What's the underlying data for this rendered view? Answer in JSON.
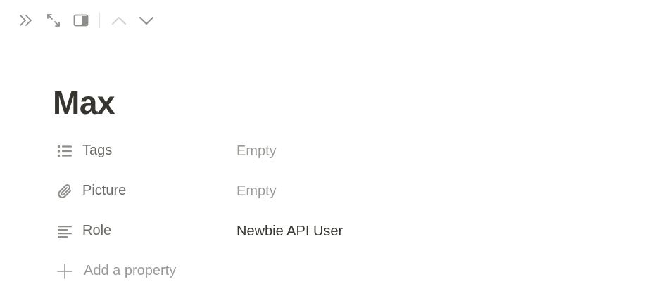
{
  "toolbar": {
    "buttons": [
      {
        "icon": "double-chevron-right-icon"
      },
      {
        "icon": "expand-diagonal-icon"
      },
      {
        "icon": "side-peek-icon"
      },
      {
        "icon": "chevron-up-icon"
      },
      {
        "icon": "chevron-down-icon"
      }
    ]
  },
  "page": {
    "title": "Max"
  },
  "properties": [
    {
      "icon": "list-icon",
      "label": "Tags",
      "value": "Empty",
      "empty": true
    },
    {
      "icon": "paperclip-icon",
      "label": "Picture",
      "value": "Empty",
      "empty": true
    },
    {
      "icon": "text-lines-icon",
      "label": "Role",
      "value": "Newbie API User",
      "empty": false
    }
  ],
  "add_property": {
    "icon": "plus-icon",
    "label": "Add a property"
  },
  "colors": {
    "text_primary": "#37352f",
    "text_secondary": "#6b6a66",
    "text_placeholder": "#9b9a97",
    "icon_gray": "#8f8e8a",
    "icon_disabled": "#d3d2cf"
  }
}
